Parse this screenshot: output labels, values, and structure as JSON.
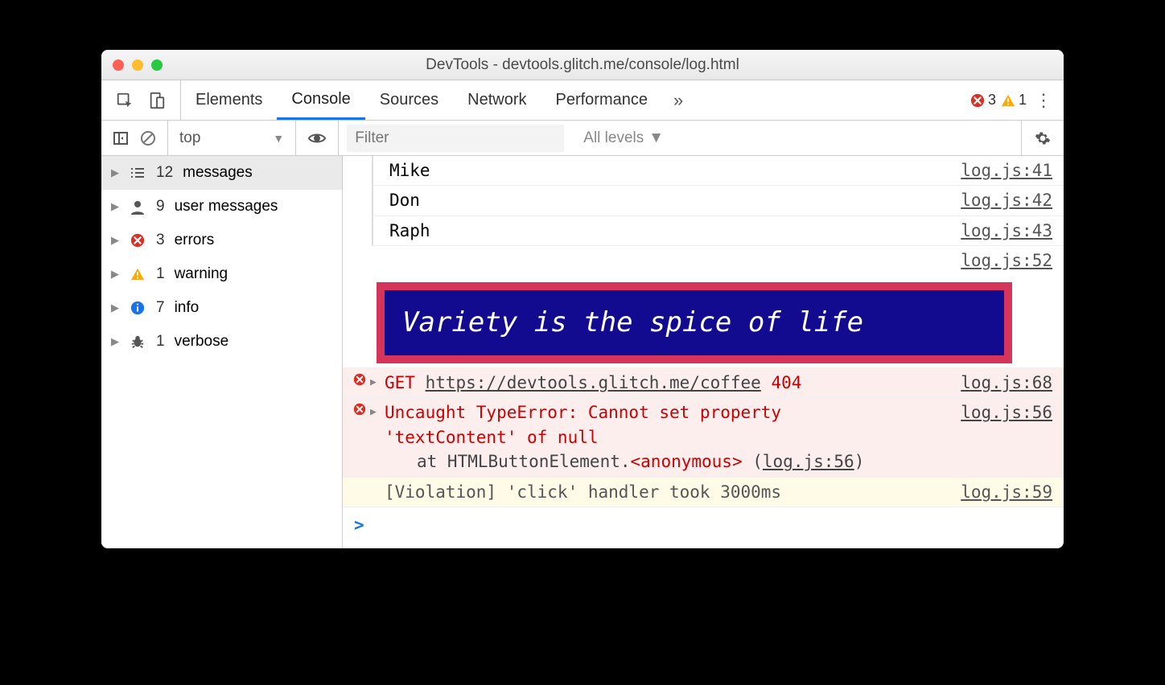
{
  "window": {
    "title": "DevTools - devtools.glitch.me/console/log.html"
  },
  "tabs": {
    "elements": "Elements",
    "console": "Console",
    "sources": "Sources",
    "network": "Network",
    "performance": "Performance"
  },
  "status": {
    "errors": "3",
    "warnings": "1"
  },
  "console_toolbar": {
    "context": "top",
    "filter_placeholder": "Filter",
    "levels": "All levels"
  },
  "sidebar": {
    "messages": {
      "count": "12",
      "label": "messages"
    },
    "user_messages": {
      "count": "9",
      "label": "user messages"
    },
    "errors": {
      "count": "3",
      "label": "errors"
    },
    "warnings": {
      "count": "1",
      "label": "warning"
    },
    "info": {
      "count": "7",
      "label": "info"
    },
    "verbose": {
      "count": "1",
      "label": "verbose"
    }
  },
  "logs": {
    "l0": {
      "msg": "Mike",
      "src": "log.js:41"
    },
    "l1": {
      "msg": "Don",
      "src": "log.js:42"
    },
    "l2": {
      "msg": "Raph",
      "src": "log.js:43"
    },
    "l3": {
      "src": "log.js:52"
    },
    "banner": "Variety is the spice of life",
    "l4": {
      "method": "GET",
      "url": "https://devtools.glitch.me/coffee",
      "status": "404",
      "src": "log.js:68"
    },
    "l5": {
      "line1": "Uncaught TypeError: Cannot set property",
      "line2": "'textContent' of null",
      "stack_prefix": "at HTMLButtonElement.",
      "stack_fn": "<anonymous>",
      "stack_loc": "log.js:56",
      "src": "log.js:56"
    },
    "l6": {
      "msg": "[Violation] 'click' handler took 3000ms",
      "src": "log.js:59"
    }
  },
  "prompt": ">"
}
